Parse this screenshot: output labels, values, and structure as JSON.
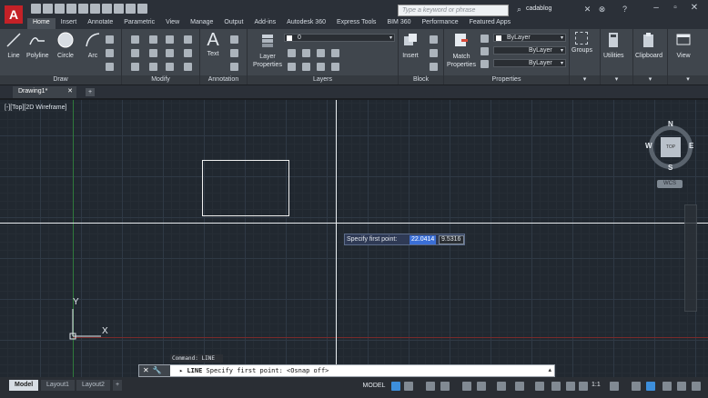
{
  "app": {
    "logo_letter": "A",
    "search_placeholder": "Type a keyword or phrase",
    "user": "cadablog",
    "window_controls": [
      "minimize-icon",
      "maximize-icon",
      "close-icon"
    ]
  },
  "ribbon": {
    "tabs": [
      "Home",
      "Insert",
      "Annotate",
      "Parametric",
      "View",
      "Manage",
      "Output",
      "Add-ins",
      "Autodesk 360",
      "Express Tools",
      "BIM 360",
      "Performance",
      "Featured Apps"
    ],
    "active_tab": "Home",
    "draw": {
      "title": "Draw",
      "tools": [
        "Line",
        "Polyline",
        "Circle",
        "Arc"
      ]
    },
    "modify": {
      "title": "Modify"
    },
    "annotation": {
      "title": "Annotation",
      "text": "Text"
    },
    "layers": {
      "title": "Layers",
      "layer_properties": "Layer Properties",
      "current_layer": "0"
    },
    "block": {
      "title": "Block",
      "insert": "Insert"
    },
    "properties": {
      "title": "Properties",
      "match": "Match Properties",
      "color": "ByLayer",
      "linetype": "ByLayer",
      "lineweight": "ByLayer"
    },
    "groups": "Groups",
    "utilities": "Utilities",
    "clipboard": "Clipboard",
    "view": "View"
  },
  "document": {
    "tab": "Drawing1*"
  },
  "canvas": {
    "viewport_label": "[-][Top][2D Wireframe]",
    "prompt": "Specify first point:",
    "coord_x": "22.0414",
    "coord_y": "9.5316",
    "ucs_x": "X",
    "ucs_y": "Y",
    "viewcube": {
      "n": "N",
      "s": "S",
      "e": "E",
      "w": "W",
      "face": "TOP",
      "wcs": "WCS"
    }
  },
  "command": {
    "history": "Command: LINE",
    "name": "LINE",
    "prompt": "Specify first point:",
    "option": "<Osnap off>"
  },
  "status": {
    "layouts": [
      "Model",
      "Layout1",
      "Layout2"
    ],
    "active_layout": "Model",
    "model": "MODEL",
    "scale": "1:1"
  }
}
